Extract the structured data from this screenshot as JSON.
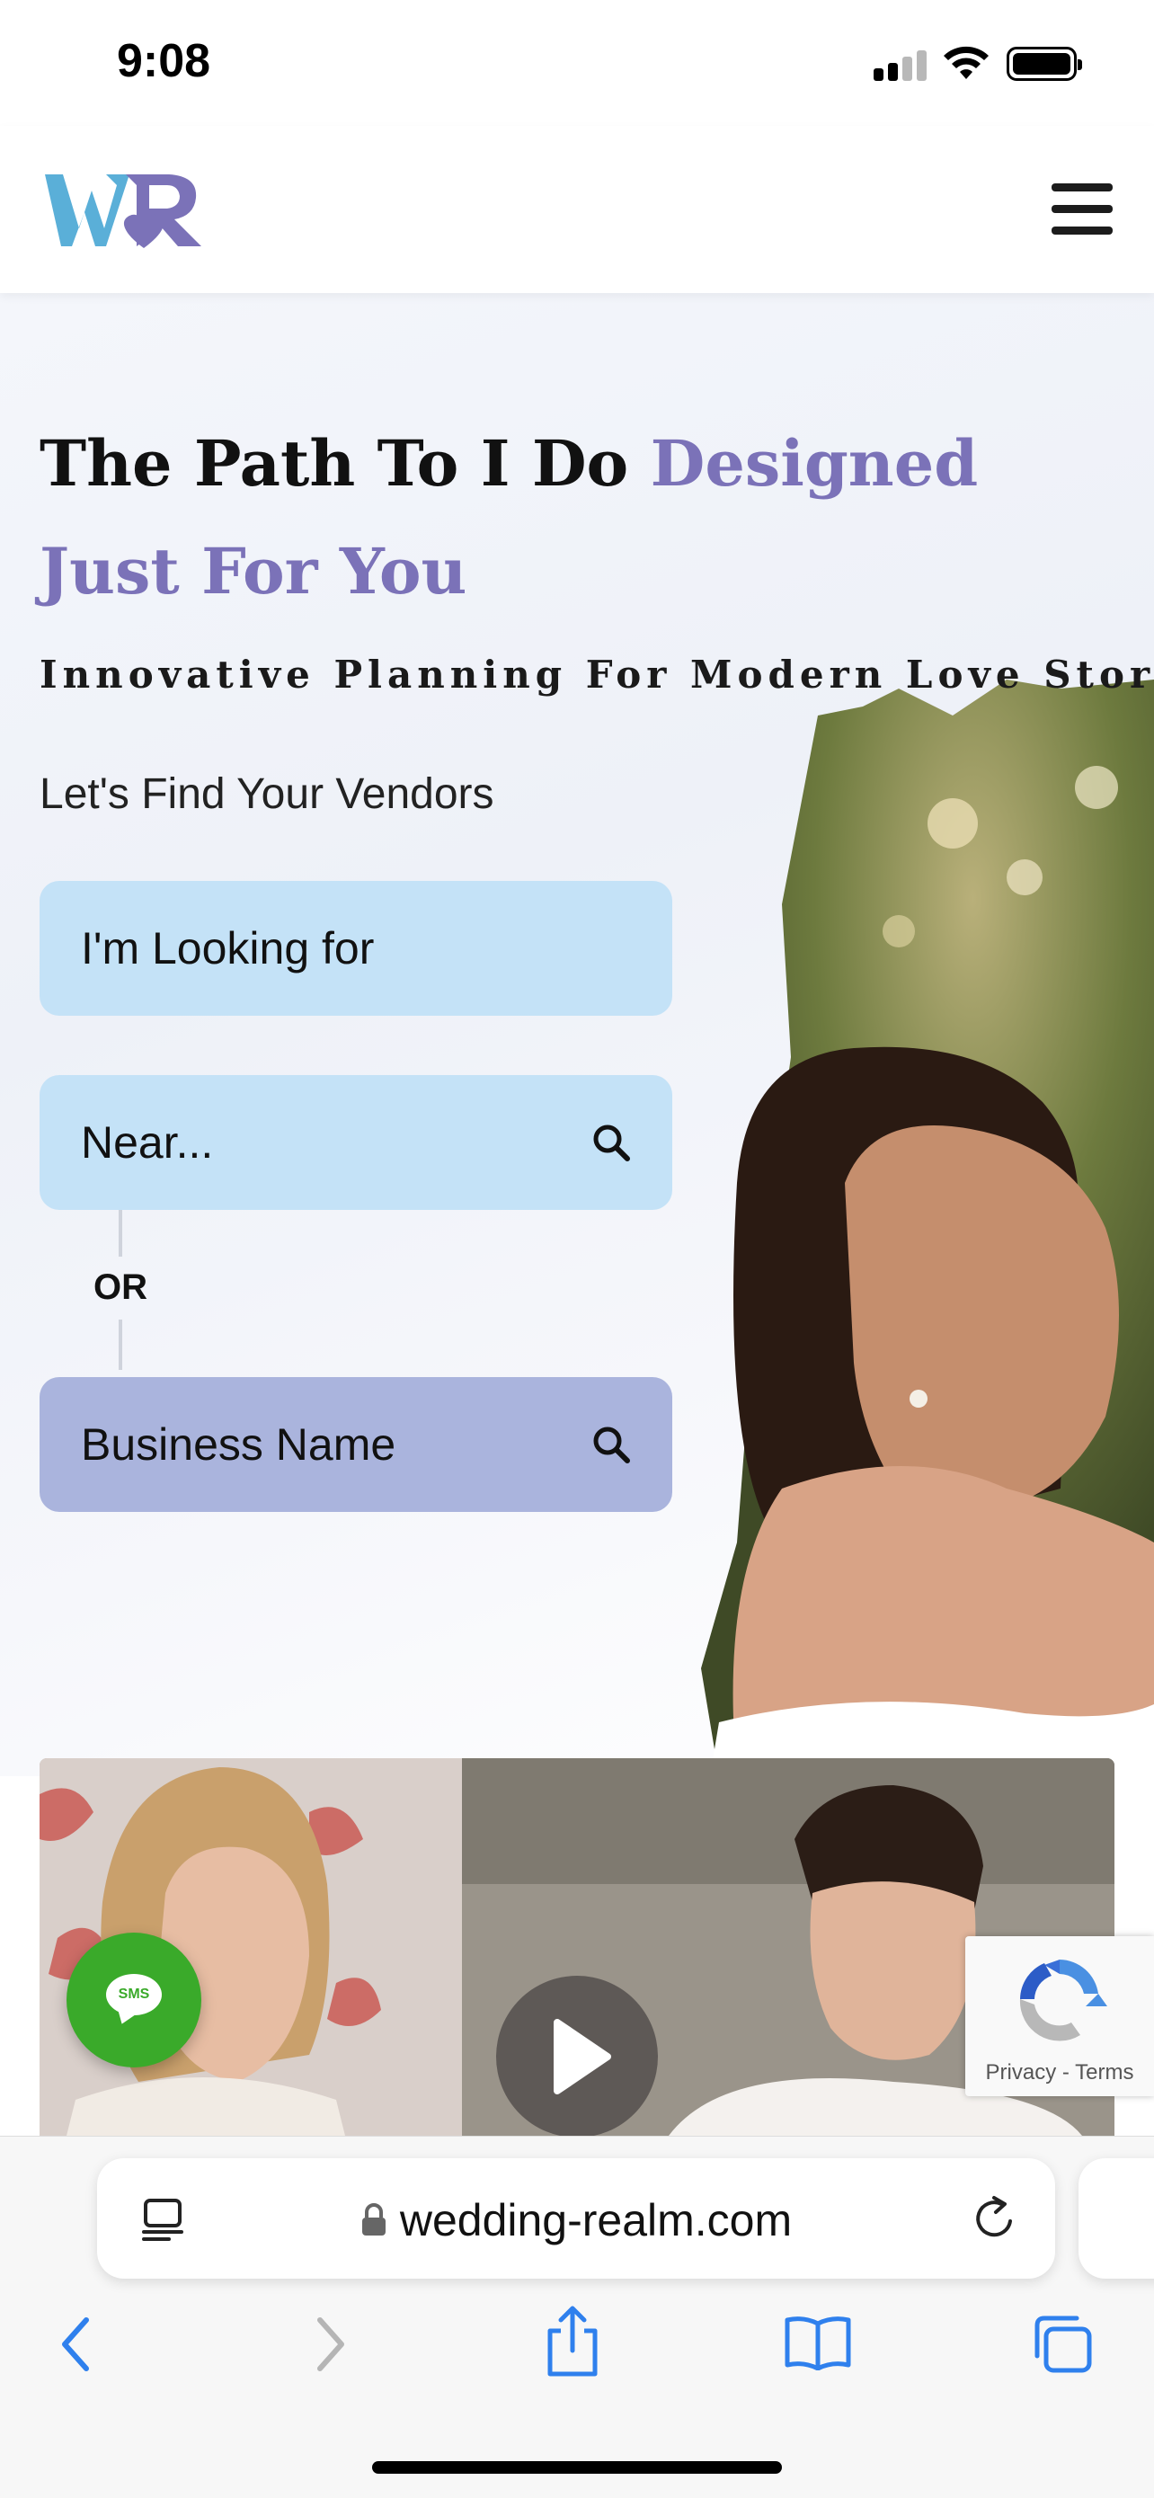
{
  "status_bar": {
    "time": "9:08"
  },
  "header": {
    "logo_text": "WR"
  },
  "hero": {
    "headline_dark": "The Path To I Do ",
    "headline_accent": "Designed Just For You",
    "tagline": "Innovative Planning For Modern Love Stories",
    "find_label": "Let's Find Your Vendors",
    "looking_for": "I'm Looking for",
    "near_placeholder": "Near...",
    "or_label": "OR",
    "business_placeholder": "Business Name"
  },
  "widgets": {
    "sms_label": "SMS",
    "recaptcha_privacy": "Privacy",
    "recaptcha_separator": " - ",
    "recaptcha_terms": "Terms"
  },
  "browser": {
    "url": "wedding-realm.com"
  },
  "colors": {
    "accent": "#7b72b8",
    "field_blue": "#c4e2f7",
    "field_purple": "#aab4dd",
    "sms_green": "#3aaa2a",
    "ios_blue": "#2f80ed"
  }
}
